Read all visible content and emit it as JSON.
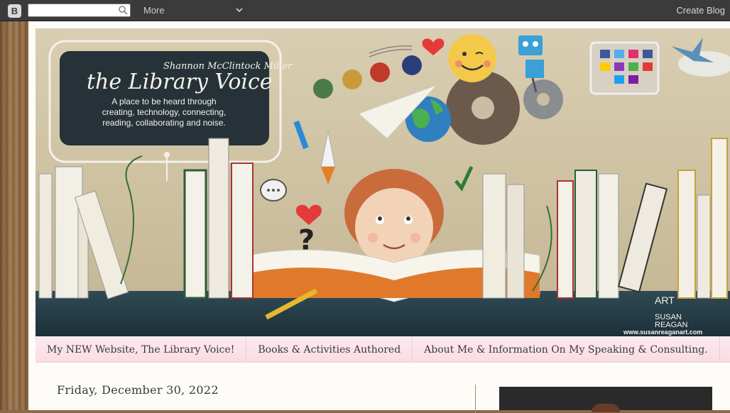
{
  "navbar": {
    "logo_letter": "B",
    "search_placeholder": "",
    "more_label": "More",
    "create_blog_label": "Create Blog"
  },
  "header": {
    "author_name": "Shannon McClintock Miller",
    "blog_title": "the Library Voice",
    "tagline_lines": [
      "A place to be heard through",
      "creating, technology, connecting,",
      "reading, collaborating and noise."
    ],
    "art_credit": [
      "ART",
      "SUSAN",
      "REAGAN"
    ],
    "art_url": "www.susanreaganart.com"
  },
  "tabs": [
    {
      "label": "My NEW Website, The Library Voice!"
    },
    {
      "label": "Books & Activities Authored"
    },
    {
      "label": "About Me & Information On My Speaking & Consulting."
    }
  ],
  "post": {
    "date": "Friday, December 30, 2022"
  },
  "colors": {
    "navbar_bg": "#3b3b3b",
    "tab_bg": "#fde9ef",
    "page_bg": "#fdfcf8"
  }
}
